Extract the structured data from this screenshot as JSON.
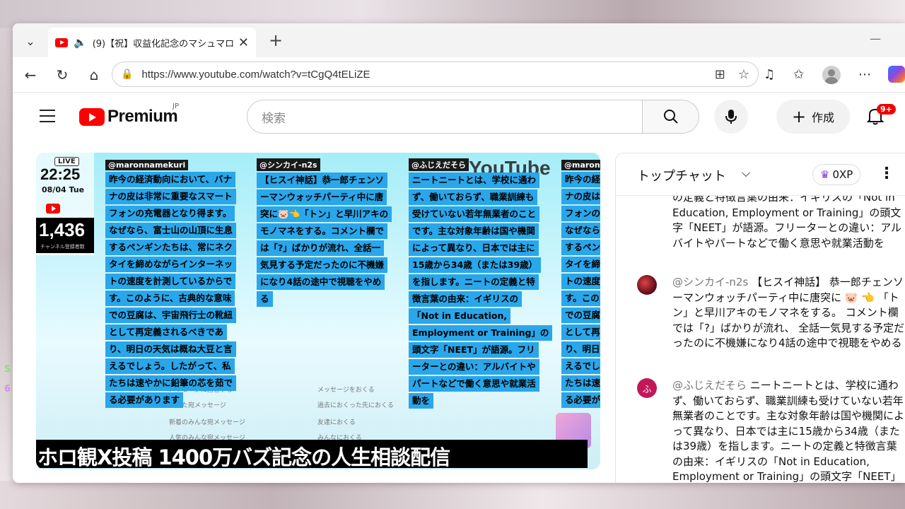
{
  "browser": {
    "tab_title": "(9)【祝】収益化記念のマシュマロ",
    "url": "https://www.youtube.com/watch?v=tCgQ4tELiZE",
    "new_tab_label": "+"
  },
  "youtube": {
    "logo_text": "Premium",
    "region": "JP",
    "search_placeholder": "検索",
    "create_label": "作成",
    "notif_badge": "9+"
  },
  "video": {
    "live_label": "LIVE",
    "clock": "22:25",
    "date": "08/04 Tue",
    "subscriber_count": "1,436",
    "subscriber_label": "チャンネル登録者数",
    "watermark": "YouTube",
    "columns": [
      {
        "author": "@maronnamekuri",
        "lines": [
          "昨今の経済動向において、バナ",
          "ナの皮は非常に重要なスマート",
          "フォンの充電器となり得ます。",
          "なぜなら、富士山の山頂に生息",
          "するペンギンたちは、常にネク",
          "タイを締めながらインターネッ",
          "トの速度を計測しているからで",
          "す。このように、古典的な意味",
          "での豆腐は、宇宙飛行士の靴紐",
          "として再定義されるべきであ",
          "り、明日の天気は概ね大豆と言",
          "えるでしょう。したがって、私",
          "たちは速やかに鉛筆の芯を茹で",
          "る必要があります"
        ]
      },
      {
        "author": "@シンカイ-n2s",
        "lines": [
          "【ヒスイ神話】恭一郎チェンソ",
          "ーマンウォッチパーティ中に唐",
          "突に🐷👈「トン」と早川アキの",
          "モノマネをする。コメント欄で",
          "は「?」ばかりが流れ、全話一",
          "気見する予定だったのに不機嫌",
          "になり4話の途中で視聴をやめ",
          "る"
        ]
      },
      {
        "author": "@ふじえだそら",
        "lines": [
          "ニートニートとは、学校に通わ",
          "ず、働いておらず、職業訓練も",
          "受けていない若年無業者のこと",
          "です。主な対象年齢は国や機関",
          "によって異なり、日本では主に",
          "15歳から34歳（または39歳）",
          "を指します。ニートの定義と特",
          "徴言葉の由来：イギリスの",
          "「Not in Education,",
          "Employment or Training」の",
          "頭文字「NEET」が語源。フリ",
          "ーターとの違い：アルバイトや",
          "パートなどで働く意思や就業活",
          "動を"
        ]
      },
      {
        "author": "@maronn",
        "lines": [
          "昨今の経",
          "ナの皮は",
          "フォンの",
          "なぜなら",
          "するペン",
          "タイを締",
          "トの速度",
          "す。この",
          "での豆腐",
          "として再",
          "り、明日",
          "えるでし",
          "たちは速",
          "る必要が"
        ]
      }
    ],
    "bg_menu": [
      "メッセージに回答する",
      "あなた宛メッセージ",
      "新着のみんな宛メッセージ",
      "人気のみんな宛メッセージ",
      "メッセージをおくる",
      "過去におくった先におくる",
      "友達におくる",
      "みんなにおくる"
    ],
    "caption": "ホロ観X投稿 1400万バズ記念の人生相談配信"
  },
  "chat": {
    "title": "トップチャット",
    "xp": "0XP",
    "messages": [
      {
        "author": "",
        "avatar_color": "",
        "text": "の定義と特徴言葉の由来：イギリスの「Not in Education, Employment or Training」の頭文字「NEET」が語源。フリーターとの違い：アルバイトやパートなどで働く意思や就業活動を"
      },
      {
        "author": "@シンカイ-n2s",
        "avatar_color": "#8a1a2a",
        "text": "【ヒスイ神話】 恭一郎チェンソーマンウォッチパーティ中に唐突に 🐷 👈 「トン」と早川アキのモノマネをする。 コメント欄では「?」ばかりが流れ、 全話一気見する予定だ ったのに不機嫌になり4話の途中で視聴をやめる"
      },
      {
        "author": "@ふじえだそら",
        "avatar_color": "#c2185b",
        "avatar_letter": "ふ",
        "text": "ニートニートとは、学校に通わず、働いておらず、職業訓練も受けていない若年無業者のことです。主な対象年齢は国や機関によって異なり、日本では主に15歳から34歳（または39歳）を指します。ニートの定義と特徴言葉の由来：イギリスの「Not in Education, Employment or Training」の頭文字「NEET」が語源。フリーターとの違"
      }
    ]
  }
}
